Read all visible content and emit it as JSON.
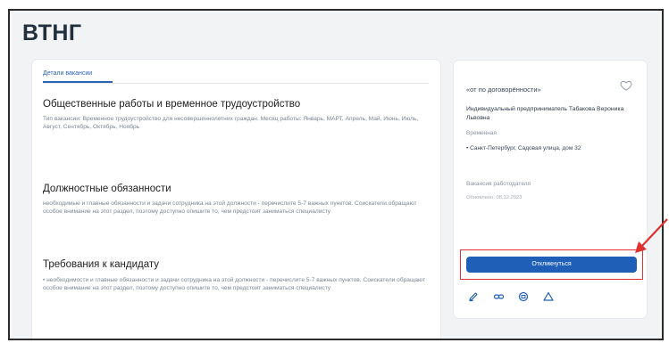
{
  "page": {
    "title": "ВТНГ"
  },
  "tabs": {
    "active_label": "Детали вакансии"
  },
  "sections": [
    {
      "heading": "Общественные работы и временное трудоустройство",
      "text": "Тип вакансии: Временное трудоустройство для несовершеннолетних граждан. Месяц работы: Январь, МАРТ, Апрель, Май, Июнь, Июль, Август, Сентябрь, Октябрь, Ноябрь"
    },
    {
      "heading": "Должностные обязанности",
      "text": "необходимые и главные обязанности и задачи сотрудника на этой должности - перечислите 5-7 важных пунктов. Соискатели обращают особое внимание на этот раздел, поэтому доступно опишите то, чем предстоит заниматься специалисту"
    },
    {
      "heading": "Требования к кандидату",
      "text": "• необходимости и главные обязанности и задачи сотрудника на этой должности - перечислите 5-7 важных пунктов. Соискатели обращают особое внимание на этот раздел, поэтому доступно опишите то, чем предстоит заниматься специалисту"
    }
  ],
  "sidebar": {
    "salary": "«от по договорённости»",
    "employer": "Индивидуальный предприниматель Табакова Вероника Львовна",
    "employer_sub": "Временная",
    "address": "• Санкт-Петербург, Садовая улица, дом 32",
    "extra": "Вакансия работодателя",
    "date": "Обновлено: 08.12.2023",
    "respond_label": "Откликнуться",
    "icons": [
      "edit-icon",
      "link-icon",
      "print-icon",
      "report-icon"
    ]
  },
  "colors": {
    "accent": "#1f5fb8",
    "highlight": "#e03030",
    "background": "#f2f3f5"
  }
}
